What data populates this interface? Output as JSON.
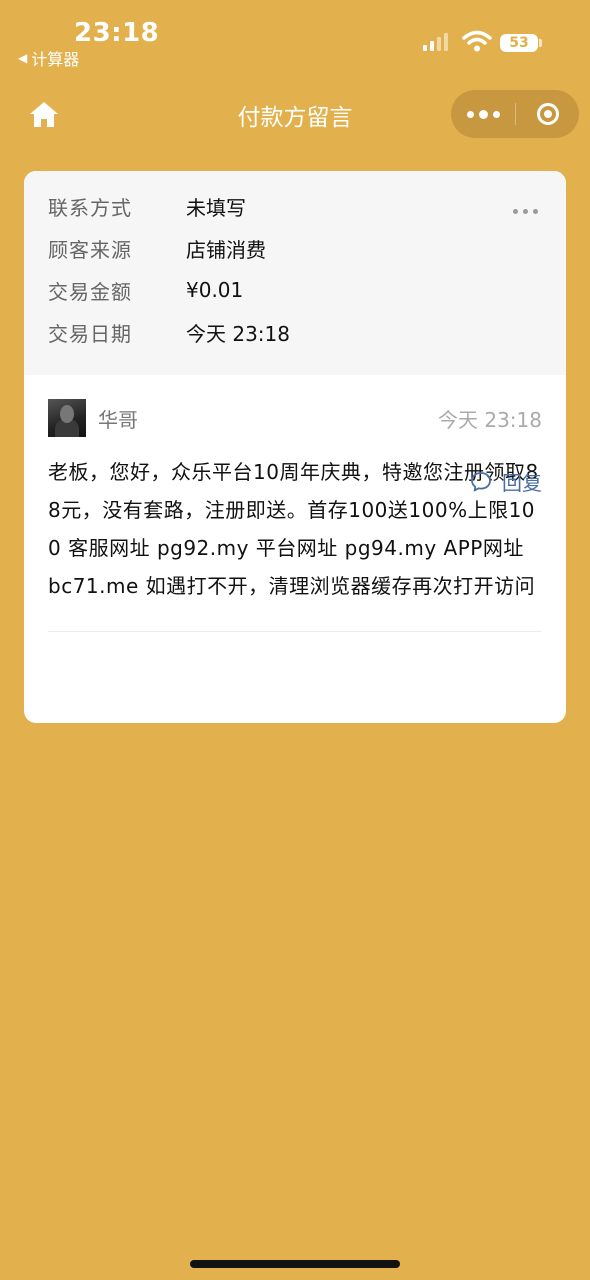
{
  "status_bar": {
    "time": "23:18",
    "back_app": "计算器",
    "battery": "53"
  },
  "nav": {
    "title": "付款方留言"
  },
  "info": {
    "rows": [
      {
        "label": "联系方式",
        "value": "未填写"
      },
      {
        "label": "顾客来源",
        "value": "店铺消费"
      },
      {
        "label": "交易金额",
        "value": "¥0.01"
      },
      {
        "label": "交易日期",
        "value": "今天 23:18"
      }
    ]
  },
  "message": {
    "user": "华哥",
    "time": "今天 23:18",
    "text": "老板，您好，众乐平台10周年庆典，特邀您注册领取88元，没有套路，注册即送。首存100送100%上限100 客服网址 pg92.my 平台网址 pg94.my APP网址 bc71.me 如遇打不开，清理浏览器缓存再次打开访问",
    "reply_label": "回复"
  },
  "colors": {
    "background": "#e2b04c",
    "link": "#4a6ea3"
  }
}
